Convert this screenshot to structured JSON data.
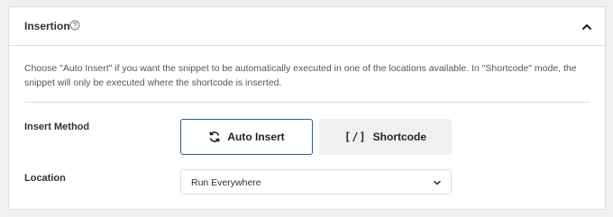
{
  "section": {
    "title": "Insertion",
    "description": "Choose \"Auto Insert\" if you want the snippet to be automatically executed in one of the locations available. In \"Shortcode\" mode, the snippet will only be executed where the shortcode is inserted."
  },
  "insert_method": {
    "label": "Insert Method",
    "options": [
      {
        "label": "Auto Insert",
        "icon": "refresh-icon",
        "selected": true
      },
      {
        "label": "Shortcode",
        "icon": "shortcode-icon",
        "selected": false
      }
    ]
  },
  "location": {
    "label": "Location",
    "selected": "Run Everywhere"
  },
  "colors": {
    "selected_border": "#2c5a9e",
    "panel_bg": "#ffffff",
    "page_bg": "#f0f0f1"
  }
}
